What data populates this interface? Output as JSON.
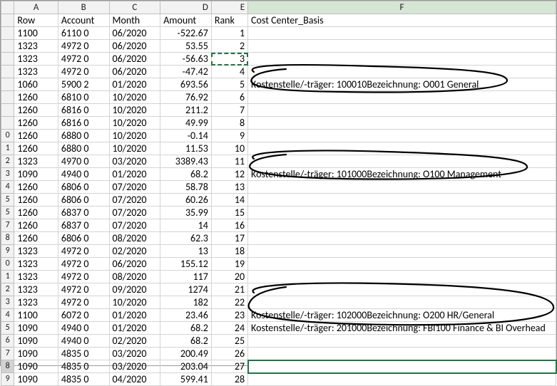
{
  "columns": [
    "A",
    "B",
    "C",
    "D",
    "E",
    "F"
  ],
  "headers": {
    "A": "Row",
    "B": "Account",
    "C": "Month",
    "D": "Amount",
    "E": "Rank",
    "F": "Cost Center_Basis"
  },
  "rows": [
    {
      "n": "",
      "A": "1100",
      "B": "6110 0",
      "C": "06/2020",
      "D": "-522.67",
      "E": "1",
      "F": ""
    },
    {
      "n": "",
      "A": "1323",
      "B": "4972 0",
      "C": "06/2020",
      "D": "53.55",
      "E": "2",
      "F": ""
    },
    {
      "n": "",
      "A": "1323",
      "B": "4972 0",
      "C": "06/2020",
      "D": "-56.63",
      "E": "3",
      "F": ""
    },
    {
      "n": "",
      "A": "1323",
      "B": "4972 0",
      "C": "06/2020",
      "D": "-47.42",
      "E": "4",
      "F": ""
    },
    {
      "n": "",
      "A": "1060",
      "B": "5900 2",
      "C": "01/2020",
      "D": "693.56",
      "E": "5",
      "F": "Kostenstelle/-träger: 100010Bezeichnung: O001 General"
    },
    {
      "n": "",
      "A": "1260",
      "B": "6810 0",
      "C": "10/2020",
      "D": "76.92",
      "E": "6",
      "F": ""
    },
    {
      "n": "",
      "A": "1260",
      "B": "6816 0",
      "C": "10/2020",
      "D": "211.2",
      "E": "7",
      "F": ""
    },
    {
      "n": "",
      "A": "1260",
      "B": "6816 0",
      "C": "10/2020",
      "D": "49.99",
      "E": "8",
      "F": ""
    },
    {
      "n": "0",
      "A": "1260",
      "B": "6880 0",
      "C": "10/2020",
      "D": "-0.14",
      "E": "9",
      "F": ""
    },
    {
      "n": "1",
      "A": "1260",
      "B": "6880 0",
      "C": "10/2020",
      "D": "11.53",
      "E": "10",
      "F": ""
    },
    {
      "n": "2",
      "A": "1323",
      "B": "4970 0",
      "C": "03/2020",
      "D": "3389.43",
      "E": "11",
      "F": ""
    },
    {
      "n": "3",
      "A": "1090",
      "B": "4940 0",
      "C": "01/2020",
      "D": "68.2",
      "E": "12",
      "F": "Kostenstelle/-träger: 101000Bezeichnung: O100 Management"
    },
    {
      "n": "4",
      "A": "1260",
      "B": "6806 0",
      "C": "07/2020",
      "D": "58.78",
      "E": "13",
      "F": ""
    },
    {
      "n": "5",
      "A": "1260",
      "B": "6806 0",
      "C": "07/2020",
      "D": "60.26",
      "E": "14",
      "F": ""
    },
    {
      "n": "5",
      "A": "1260",
      "B": "6837 0",
      "C": "07/2020",
      "D": "35.99",
      "E": "15",
      "F": ""
    },
    {
      "n": "7",
      "A": "1260",
      "B": "6837 0",
      "C": "07/2020",
      "D": "14",
      "E": "16",
      "F": ""
    },
    {
      "n": "8",
      "A": "1260",
      "B": "6806 0",
      "C": "08/2020",
      "D": "62.3",
      "E": "17",
      "F": ""
    },
    {
      "n": "9",
      "A": "1323",
      "B": "4972 0",
      "C": "02/2020",
      "D": "13",
      "E": "18",
      "F": ""
    },
    {
      "n": "0",
      "A": "1323",
      "B": "4972 0",
      "C": "06/2020",
      "D": "155.12",
      "E": "19",
      "F": ""
    },
    {
      "n": "1",
      "A": "1323",
      "B": "4972 0",
      "C": "08/2020",
      "D": "117",
      "E": "20",
      "F": ""
    },
    {
      "n": "2",
      "A": "1323",
      "B": "4972 0",
      "C": "09/2020",
      "D": "1274",
      "E": "21",
      "F": ""
    },
    {
      "n": "3",
      "A": "1323",
      "B": "4972 0",
      "C": "10/2020",
      "D": "182",
      "E": "22",
      "F": ""
    },
    {
      "n": "4",
      "A": "1100",
      "B": "6072 0",
      "C": "01/2020",
      "D": "23.46",
      "E": "23",
      "F": "Kostenstelle/-träger: 102000Bezeichnung: O200 HR/General"
    },
    {
      "n": "5",
      "A": "1090",
      "B": "4940 0",
      "C": "01/2020",
      "D": "68.2",
      "E": "24",
      "F": "Kostenstelle/-träger: 201000Bezeichnung: FBI100 Finance & BI Overhead"
    },
    {
      "n": "6",
      "A": "1090",
      "B": "4940 0",
      "C": "02/2020",
      "D": "68.2",
      "E": "25",
      "F": ""
    },
    {
      "n": "7",
      "A": "1090",
      "B": "4835 0",
      "C": "03/2020",
      "D": "200.49",
      "E": "26",
      "F": ""
    },
    {
      "n": "8",
      "A": "1090",
      "B": "4835 0",
      "C": "03/2020",
      "D": "203.04",
      "E": "27",
      "F": ""
    },
    {
      "n": "9",
      "A": "1090",
      "B": "4835 0",
      "C": "04/2020",
      "D": "599.41",
      "E": "28",
      "F": ""
    }
  ],
  "copied_cell_row_index": 2,
  "selected_cell_row_index": 26,
  "selected_row_header_index": 26
}
